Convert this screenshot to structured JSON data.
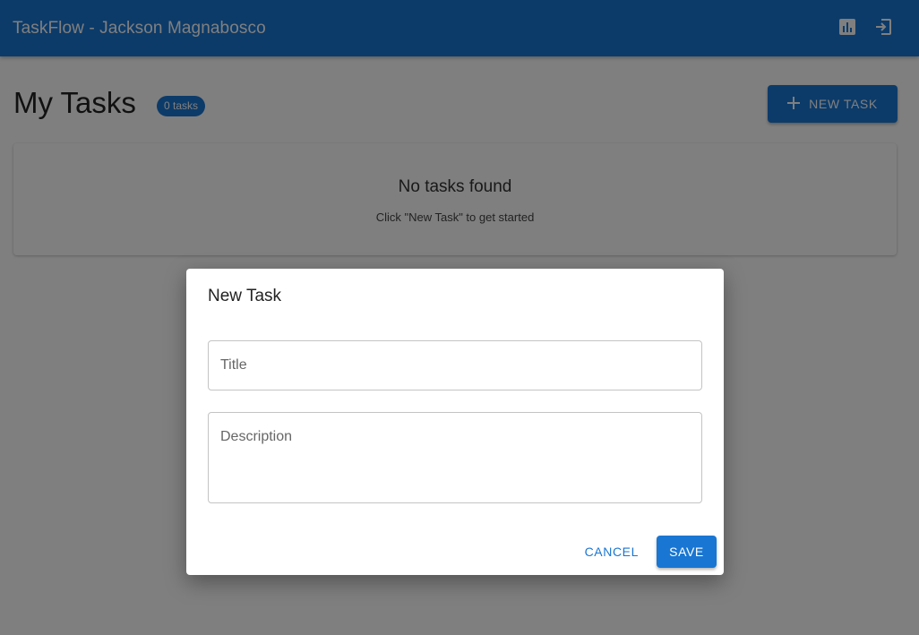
{
  "appbar": {
    "title": "TaskFlow - Jackson Magnabosco",
    "actions": [
      {
        "icon": "stats-icon"
      },
      {
        "icon": "logout-icon"
      }
    ]
  },
  "page": {
    "title": "My Tasks",
    "task_count": "0 tasks",
    "new_task_label": "NEW TASK"
  },
  "empty_state": {
    "title": "No tasks found",
    "subtitle": "Click \"New Task\" to get started"
  },
  "dialog": {
    "title": "New Task",
    "title_field": {
      "value": "",
      "placeholder": "Title"
    },
    "description_field": {
      "value": "",
      "placeholder": "Description"
    },
    "cancel_label": "CANCEL",
    "save_label": "SAVE"
  },
  "colors": {
    "primary": "#1976d2",
    "overlay": "rgba(0,0,0,0.5)"
  }
}
